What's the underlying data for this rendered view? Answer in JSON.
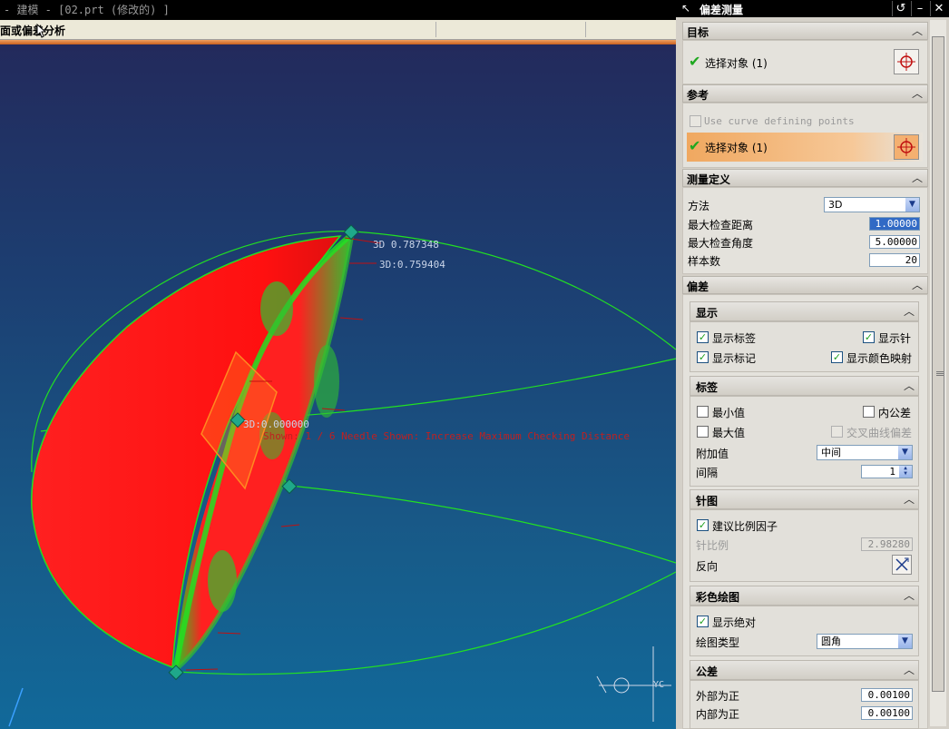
{
  "window": {
    "title": "- 建模 - [02.prt  (修改的) ]",
    "menu_label": "面或偏差分析"
  },
  "viewport": {
    "label_3d_top": "3D 0.787348",
    "label_3d_2": "3D:0.759404",
    "label_center": "3D:0.000000",
    "warning": "Shown: 1 / 6 Needle Shown: Increase Maximum Checking Distance",
    "axis_label": "YC"
  },
  "dialog": {
    "title": "偏差测量",
    "target": {
      "header": "目标",
      "select_label": "选择对象 (1)"
    },
    "reference": {
      "header": "参考",
      "use_curve_label": "Use curve defining points",
      "use_curve_checked": false,
      "select_label": "选择对象 (1)"
    },
    "measure_def": {
      "header": "测量定义",
      "method_label": "方法",
      "method_value": "3D",
      "max_dist_label": "最大检查距离",
      "max_dist_value": "1.00000",
      "max_angle_label": "最大检查角度",
      "max_angle_value": "5.00000",
      "samples_label": "样本数",
      "samples_value": "20"
    },
    "deviation": {
      "header": "偏差",
      "display": {
        "header": "显示",
        "show_labels": "显示标签",
        "show_needles": "显示针",
        "show_markers": "显示标记",
        "show_color_map": "显示颜色映射"
      },
      "labels": {
        "header": "标签",
        "min_value": "最小值",
        "inner_tol": "内公差",
        "max_value": "最大值",
        "cross_curve": "交叉曲线偏差",
        "additional_label": "附加值",
        "additional_value": "中间",
        "interval_label": "间隔",
        "interval_value": "1"
      },
      "needle": {
        "header": "针图",
        "suggest_scale": "建议比例因子",
        "scale_label": "针比例",
        "scale_value": "2.98280",
        "reverse_label": "反向"
      },
      "color_plot": {
        "header": "彩色绘图",
        "show_absolute": "显示绝对",
        "plot_type_label": "绘图类型",
        "plot_type_value": "圆角"
      },
      "tolerance": {
        "header": "公差",
        "outer_label": "外部为正",
        "outer_value": "0.00100",
        "inner_label": "内部为正",
        "inner_value": "0.00100"
      }
    }
  },
  "colors": {
    "accent_highlight": "#f0b070",
    "surface": "#ff1a1a",
    "curve": "#22e022"
  }
}
